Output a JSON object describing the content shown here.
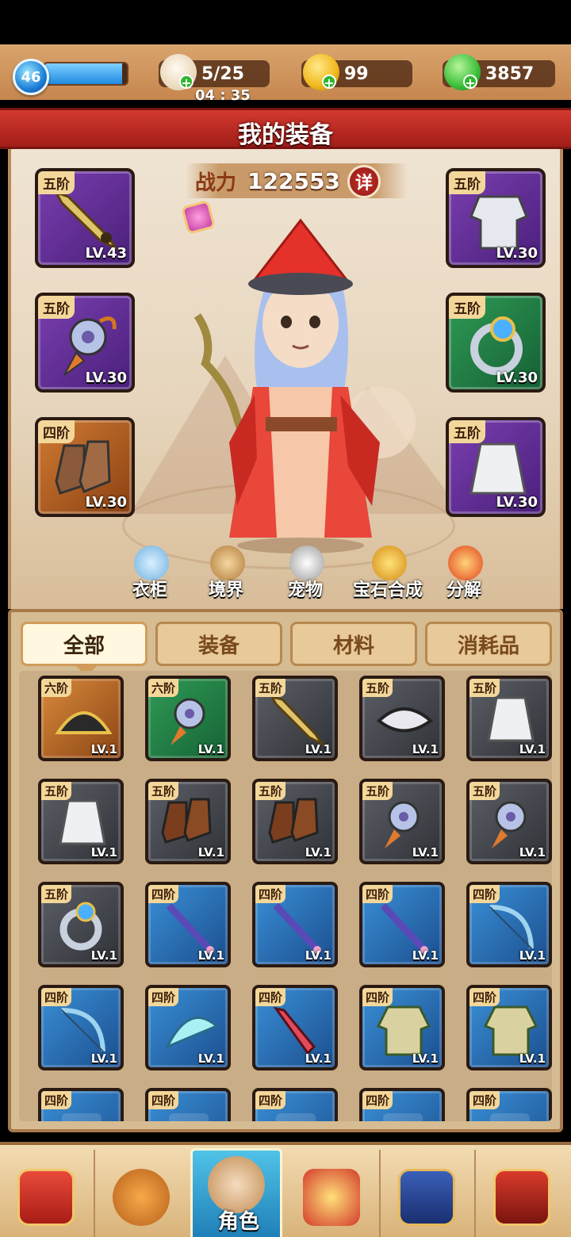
{
  "topbar": {
    "level": "46",
    "xp_fraction": 0.94,
    "stamina": "5/25",
    "stamina_timer": "04 : 35",
    "gold": "99",
    "jade": "3857"
  },
  "header": {
    "title": "我的装备"
  },
  "character": {
    "power_label": "战力",
    "power_value": "122553",
    "detail_label": "详",
    "left_slots": [
      {
        "tier": "五阶",
        "level": "LV.43",
        "rarity": "purple",
        "icon": "sword-icon"
      },
      {
        "tier": "五阶",
        "level": "LV.30",
        "rarity": "purple",
        "icon": "pendant-icon"
      },
      {
        "tier": "四阶",
        "level": "LV.30",
        "rarity": "orange",
        "icon": "boots-icon"
      }
    ],
    "right_slots": [
      {
        "tier": "五阶",
        "level": "LV.30",
        "rarity": "purple",
        "icon": "armor-icon"
      },
      {
        "tier": "五阶",
        "level": "LV.30",
        "rarity": "green",
        "icon": "ring-icon"
      },
      {
        "tier": "五阶",
        "level": "LV.30",
        "rarity": "purple",
        "icon": "skirt-icon"
      }
    ],
    "functions": [
      {
        "label": "衣柜",
        "icon": "wardrobe-icon"
      },
      {
        "label": "境界",
        "icon": "realm-icon"
      },
      {
        "label": "宠物",
        "icon": "pet-icon"
      },
      {
        "label": "宝石合成",
        "icon": "gem-synthesis-icon"
      },
      {
        "label": "分解",
        "icon": "decompose-icon"
      }
    ]
  },
  "inventory": {
    "tabs": [
      "全部",
      "装备",
      "材料",
      "消耗品"
    ],
    "active_tab": "全部",
    "items": [
      {
        "tier": "六阶",
        "level": "LV.1",
        "rarity": "orange",
        "icon": "fan-icon"
      },
      {
        "tier": "六阶",
        "level": "LV.1",
        "rarity": "green",
        "icon": "pendant-icon"
      },
      {
        "tier": "五阶",
        "level": "LV.1",
        "rarity": "gray",
        "icon": "sword-icon"
      },
      {
        "tier": "五阶",
        "level": "LV.1",
        "rarity": "gray",
        "icon": "mask-icon"
      },
      {
        "tier": "五阶",
        "level": "LV.1",
        "rarity": "gray",
        "icon": "skirt-icon"
      },
      {
        "tier": "五阶",
        "level": "LV.1",
        "rarity": "gray",
        "icon": "skirt-icon"
      },
      {
        "tier": "五阶",
        "level": "LV.1",
        "rarity": "gray",
        "icon": "boots-icon"
      },
      {
        "tier": "五阶",
        "level": "LV.1",
        "rarity": "gray",
        "icon": "boots-icon"
      },
      {
        "tier": "五阶",
        "level": "LV.1",
        "rarity": "gray",
        "icon": "pendant-icon"
      },
      {
        "tier": "五阶",
        "level": "LV.1",
        "rarity": "gray",
        "icon": "pendant-icon"
      },
      {
        "tier": "五阶",
        "level": "LV.1",
        "rarity": "gray",
        "icon": "ring-icon"
      },
      {
        "tier": "四阶",
        "level": "LV.1",
        "rarity": "blue",
        "icon": "staff-icon"
      },
      {
        "tier": "四阶",
        "level": "LV.1",
        "rarity": "blue",
        "icon": "staff-icon"
      },
      {
        "tier": "四阶",
        "level": "LV.1",
        "rarity": "blue",
        "icon": "staff-icon"
      },
      {
        "tier": "四阶",
        "level": "LV.1",
        "rarity": "blue",
        "icon": "bow-icon"
      },
      {
        "tier": "四阶",
        "level": "LV.1",
        "rarity": "blue",
        "icon": "bow-icon"
      },
      {
        "tier": "四阶",
        "level": "LV.1",
        "rarity": "blue",
        "icon": "feather-fan-icon"
      },
      {
        "tier": "四阶",
        "level": "LV.1",
        "rarity": "blue",
        "icon": "dagger-icon"
      },
      {
        "tier": "四阶",
        "level": "LV.1",
        "rarity": "blue",
        "icon": "robe-icon"
      },
      {
        "tier": "四阶",
        "level": "LV.1",
        "rarity": "blue",
        "icon": "robe-icon"
      },
      {
        "tier": "四阶",
        "level": "",
        "rarity": "blue",
        "icon": "unknown-icon"
      },
      {
        "tier": "四阶",
        "level": "",
        "rarity": "blue",
        "icon": "unknown-icon"
      },
      {
        "tier": "四阶",
        "level": "",
        "rarity": "blue",
        "icon": "unknown-icon"
      },
      {
        "tier": "四阶",
        "level": "",
        "rarity": "blue",
        "icon": "unknown-icon"
      },
      {
        "tier": "四阶",
        "level": "",
        "rarity": "blue",
        "icon": "unknown-icon"
      }
    ]
  },
  "bottom_nav": [
    {
      "label": "",
      "icon": "scroll-icon"
    },
    {
      "label": "",
      "icon": "bag-icon"
    },
    {
      "label": "角色",
      "icon": "hero-portrait-icon",
      "active": true
    },
    {
      "label": "",
      "icon": "battle-icon"
    },
    {
      "label": "",
      "icon": "book-icon"
    },
    {
      "label": "",
      "icon": "shop-icon"
    }
  ]
}
